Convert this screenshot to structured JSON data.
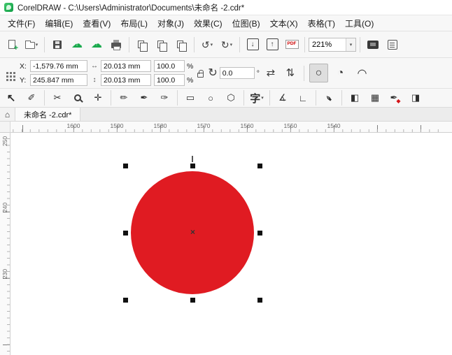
{
  "titlebar": {
    "title": "CorelDRAW - C:\\Users\\Administrator\\Documents\\未命名 -2.cdr*"
  },
  "menubar": {
    "items": [
      {
        "label": "文件(F)"
      },
      {
        "label": "编辑(E)"
      },
      {
        "label": "查看(V)"
      },
      {
        "label": "布局(L)"
      },
      {
        "label": "对象(J)"
      },
      {
        "label": "效果(C)"
      },
      {
        "label": "位图(B)"
      },
      {
        "label": "文本(X)"
      },
      {
        "label": "表格(T)"
      },
      {
        "label": "工具(O)"
      }
    ]
  },
  "toolbar": {
    "zoom_value": "221%",
    "pdf_label": "PDF"
  },
  "propertybar": {
    "x_label": "X:",
    "x_value": "-1,579.76 mm",
    "y_label": "Y:",
    "y_value": "245.847 mm",
    "width_value": "20.013 mm",
    "height_value": "20.013 mm",
    "scale_x": "100.0",
    "scale_y": "100.0",
    "percent": "%",
    "angle_value": "0.0",
    "degree": "°"
  },
  "tabbar": {
    "doc_tab": "未命名 -2.cdr*"
  },
  "rulers": {
    "horizontal": [
      "1600",
      "1590",
      "1580",
      "1570",
      "1560",
      "1550",
      "1540"
    ],
    "vertical": [
      "250",
      "240",
      "230"
    ]
  },
  "canvas": {
    "shape": "ellipse",
    "fill": "#e01b22",
    "selection_handles": 8
  },
  "colors": {
    "accent_green": "#18a94c",
    "shape_fill": "#e01b22"
  }
}
